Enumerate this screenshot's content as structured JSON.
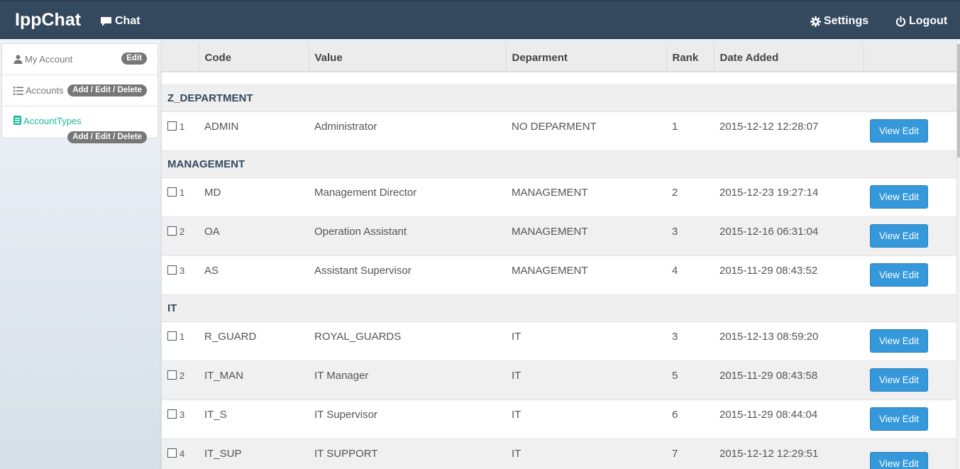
{
  "app": {
    "title": "IppChat"
  },
  "nav": {
    "chat": {
      "label": "Chat",
      "icon": "comment-icon"
    },
    "settings": {
      "label": "Settings",
      "icon": "gear-icon"
    },
    "logout": {
      "label": "Logout",
      "icon": "power-icon"
    }
  },
  "sidebar": {
    "items": [
      {
        "label": "My Account",
        "icon": "user-icon",
        "badge": "Edit"
      },
      {
        "label": "Accounts",
        "icon": "list-icon",
        "badge": "Add / Edit / Delete"
      },
      {
        "label": "AccountTypes",
        "icon": "book-icon",
        "badge": "Add / Edit / Delete",
        "active": true
      }
    ]
  },
  "table": {
    "headers": [
      "",
      "Code",
      "Value",
      "Deparment",
      "Rank",
      "Date Added",
      ""
    ],
    "action_label": "View Edit",
    "groups": [
      {
        "name": "Z_DEPARTMENT",
        "rows": [
          {
            "num": "1",
            "code": "ADMIN",
            "value": "Administrator",
            "department": "NO DEPARMENT",
            "rank": "1",
            "date": "2015-12-12 12:28:07"
          }
        ]
      },
      {
        "name": "MANAGEMENT",
        "rows": [
          {
            "num": "1",
            "code": "MD",
            "value": "Management Director",
            "department": "MANAGEMENT",
            "rank": "2",
            "date": "2015-12-23 19:27:14"
          },
          {
            "num": "2",
            "code": "OA",
            "value": "Operation Assistant",
            "department": "MANAGEMENT",
            "rank": "3",
            "date": "2015-12-16 06:31:04"
          },
          {
            "num": "3",
            "code": "AS",
            "value": "Assistant Supervisor",
            "department": "MANAGEMENT",
            "rank": "4",
            "date": "2015-11-29 08:43:52"
          }
        ]
      },
      {
        "name": "IT",
        "rows": [
          {
            "num": "1",
            "code": "R_GUARD",
            "value": "ROYAL_GUARDS",
            "department": "IT",
            "rank": "3",
            "date": "2015-12-13 08:59:20"
          },
          {
            "num": "2",
            "code": "IT_MAN",
            "value": "IT Manager",
            "department": "IT",
            "rank": "5",
            "date": "2015-11-29 08:43:58"
          },
          {
            "num": "3",
            "code": "IT_S",
            "value": "IT Supervisor",
            "department": "IT",
            "rank": "6",
            "date": "2015-11-29 08:44:04"
          },
          {
            "num": "4",
            "code": "IT_SUP",
            "value": "IT SUPPORT",
            "department": "IT",
            "rank": "7",
            "date": "2015-12-12 12:29:51"
          }
        ]
      }
    ]
  },
  "colors": {
    "navbar": "#34495e",
    "accent": "#1abc9c",
    "button": "#3498db",
    "badge": "#777777"
  }
}
